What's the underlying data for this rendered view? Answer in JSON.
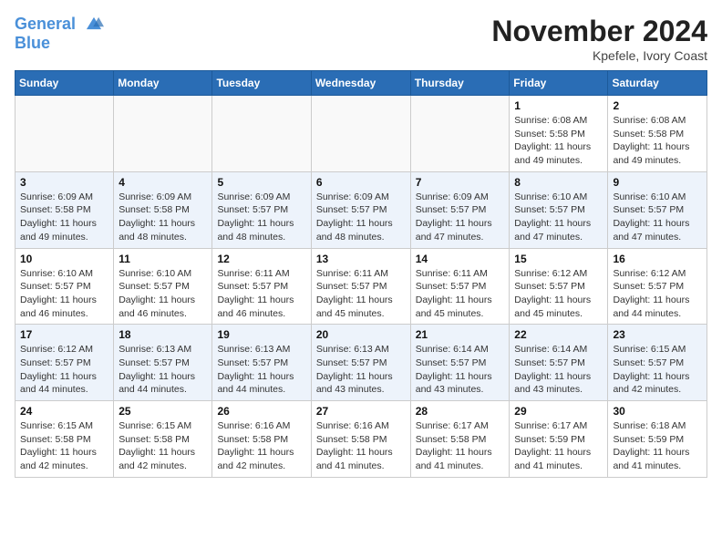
{
  "header": {
    "logo_line1": "General",
    "logo_line2": "Blue",
    "month_title": "November 2024",
    "subtitle": "Kpefele, Ivory Coast"
  },
  "weekdays": [
    "Sunday",
    "Monday",
    "Tuesday",
    "Wednesday",
    "Thursday",
    "Friday",
    "Saturday"
  ],
  "weeks": [
    [
      {
        "day": "",
        "info": ""
      },
      {
        "day": "",
        "info": ""
      },
      {
        "day": "",
        "info": ""
      },
      {
        "day": "",
        "info": ""
      },
      {
        "day": "",
        "info": ""
      },
      {
        "day": "1",
        "info": "Sunrise: 6:08 AM\nSunset: 5:58 PM\nDaylight: 11 hours\nand 49 minutes."
      },
      {
        "day": "2",
        "info": "Sunrise: 6:08 AM\nSunset: 5:58 PM\nDaylight: 11 hours\nand 49 minutes."
      }
    ],
    [
      {
        "day": "3",
        "info": "Sunrise: 6:09 AM\nSunset: 5:58 PM\nDaylight: 11 hours\nand 49 minutes."
      },
      {
        "day": "4",
        "info": "Sunrise: 6:09 AM\nSunset: 5:58 PM\nDaylight: 11 hours\nand 48 minutes."
      },
      {
        "day": "5",
        "info": "Sunrise: 6:09 AM\nSunset: 5:57 PM\nDaylight: 11 hours\nand 48 minutes."
      },
      {
        "day": "6",
        "info": "Sunrise: 6:09 AM\nSunset: 5:57 PM\nDaylight: 11 hours\nand 48 minutes."
      },
      {
        "day": "7",
        "info": "Sunrise: 6:09 AM\nSunset: 5:57 PM\nDaylight: 11 hours\nand 47 minutes."
      },
      {
        "day": "8",
        "info": "Sunrise: 6:10 AM\nSunset: 5:57 PM\nDaylight: 11 hours\nand 47 minutes."
      },
      {
        "day": "9",
        "info": "Sunrise: 6:10 AM\nSunset: 5:57 PM\nDaylight: 11 hours\nand 47 minutes."
      }
    ],
    [
      {
        "day": "10",
        "info": "Sunrise: 6:10 AM\nSunset: 5:57 PM\nDaylight: 11 hours\nand 46 minutes."
      },
      {
        "day": "11",
        "info": "Sunrise: 6:10 AM\nSunset: 5:57 PM\nDaylight: 11 hours\nand 46 minutes."
      },
      {
        "day": "12",
        "info": "Sunrise: 6:11 AM\nSunset: 5:57 PM\nDaylight: 11 hours\nand 46 minutes."
      },
      {
        "day": "13",
        "info": "Sunrise: 6:11 AM\nSunset: 5:57 PM\nDaylight: 11 hours\nand 45 minutes."
      },
      {
        "day": "14",
        "info": "Sunrise: 6:11 AM\nSunset: 5:57 PM\nDaylight: 11 hours\nand 45 minutes."
      },
      {
        "day": "15",
        "info": "Sunrise: 6:12 AM\nSunset: 5:57 PM\nDaylight: 11 hours\nand 45 minutes."
      },
      {
        "day": "16",
        "info": "Sunrise: 6:12 AM\nSunset: 5:57 PM\nDaylight: 11 hours\nand 44 minutes."
      }
    ],
    [
      {
        "day": "17",
        "info": "Sunrise: 6:12 AM\nSunset: 5:57 PM\nDaylight: 11 hours\nand 44 minutes."
      },
      {
        "day": "18",
        "info": "Sunrise: 6:13 AM\nSunset: 5:57 PM\nDaylight: 11 hours\nand 44 minutes."
      },
      {
        "day": "19",
        "info": "Sunrise: 6:13 AM\nSunset: 5:57 PM\nDaylight: 11 hours\nand 44 minutes."
      },
      {
        "day": "20",
        "info": "Sunrise: 6:13 AM\nSunset: 5:57 PM\nDaylight: 11 hours\nand 43 minutes."
      },
      {
        "day": "21",
        "info": "Sunrise: 6:14 AM\nSunset: 5:57 PM\nDaylight: 11 hours\nand 43 minutes."
      },
      {
        "day": "22",
        "info": "Sunrise: 6:14 AM\nSunset: 5:57 PM\nDaylight: 11 hours\nand 43 minutes."
      },
      {
        "day": "23",
        "info": "Sunrise: 6:15 AM\nSunset: 5:57 PM\nDaylight: 11 hours\nand 42 minutes."
      }
    ],
    [
      {
        "day": "24",
        "info": "Sunrise: 6:15 AM\nSunset: 5:58 PM\nDaylight: 11 hours\nand 42 minutes."
      },
      {
        "day": "25",
        "info": "Sunrise: 6:15 AM\nSunset: 5:58 PM\nDaylight: 11 hours\nand 42 minutes."
      },
      {
        "day": "26",
        "info": "Sunrise: 6:16 AM\nSunset: 5:58 PM\nDaylight: 11 hours\nand 42 minutes."
      },
      {
        "day": "27",
        "info": "Sunrise: 6:16 AM\nSunset: 5:58 PM\nDaylight: 11 hours\nand 41 minutes."
      },
      {
        "day": "28",
        "info": "Sunrise: 6:17 AM\nSunset: 5:58 PM\nDaylight: 11 hours\nand 41 minutes."
      },
      {
        "day": "29",
        "info": "Sunrise: 6:17 AM\nSunset: 5:59 PM\nDaylight: 11 hours\nand 41 minutes."
      },
      {
        "day": "30",
        "info": "Sunrise: 6:18 AM\nSunset: 5:59 PM\nDaylight: 11 hours\nand 41 minutes."
      }
    ]
  ]
}
